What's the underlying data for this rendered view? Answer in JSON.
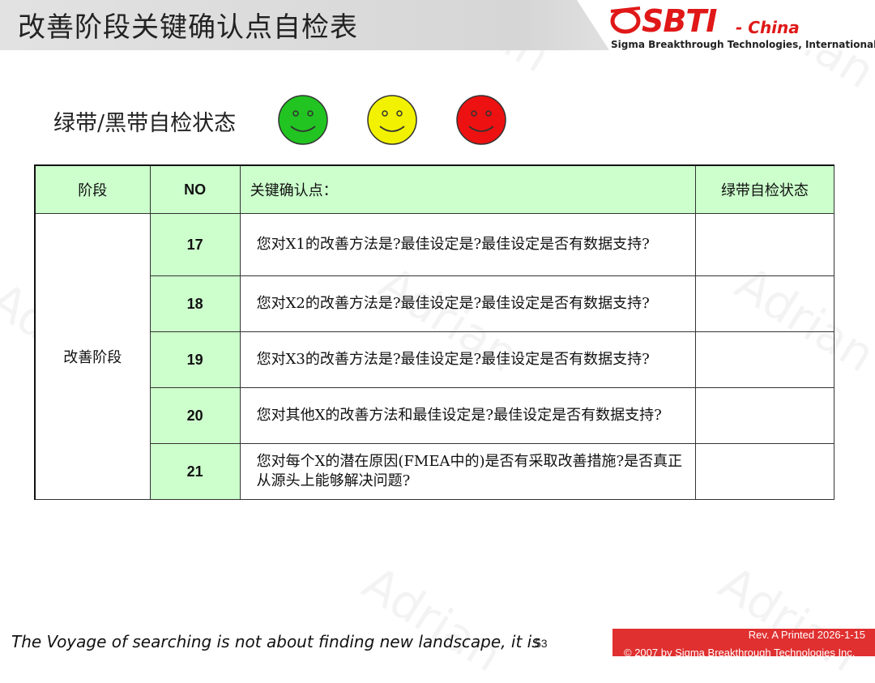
{
  "header": {
    "title": "改善阶段关键确认点自检表",
    "logo": {
      "brand": "SBTI",
      "region": "- China",
      "subtitle": "Sigma Breakthrough Technologies, International"
    }
  },
  "status": {
    "label": "绿带/黑带自检状态",
    "indicators": [
      {
        "icon": "smiley-green-icon",
        "color": "#22c422"
      },
      {
        "icon": "smiley-yellow-icon",
        "color": "#f2f200"
      },
      {
        "icon": "smiley-red-icon",
        "color": "#ee1111"
      }
    ]
  },
  "watermark": {
    "text": "Adrian"
  },
  "table": {
    "headers": {
      "phase": "阶段",
      "no": "NO",
      "checkpoint": "关键确认点：",
      "self_check": "绿带自检状态"
    },
    "phase": "改善阶段",
    "rows": [
      {
        "no": "17",
        "text": "您对X1的改善方法是?最佳设定是?最佳设定是否有数据支持?"
      },
      {
        "no": "18",
        "text": "您对X2的改善方法是?最佳设定是?最佳设定是否有数据支持?"
      },
      {
        "no": "19",
        "text": "您对X3的改善方法是?最佳设定是?最佳设定是否有数据支持?"
      },
      {
        "no": "20",
        "text": "您对其他X的改善方法和最佳设定是?最佳设定是否有数据支持?"
      },
      {
        "no": "21",
        "text": "您对每个X的潜在原因(FMEA中的)是否有采取改善措施?是否真正从源头上能够解决问题?"
      }
    ]
  },
  "footer": {
    "quote": "The Voyage of searching is not about finding new landscape, it is",
    "page": "53",
    "revision": "Rev. A   Printed 2026-1-15",
    "copyright": "© 2007 by Sigma Breakthrough Technologies Inc."
  }
}
